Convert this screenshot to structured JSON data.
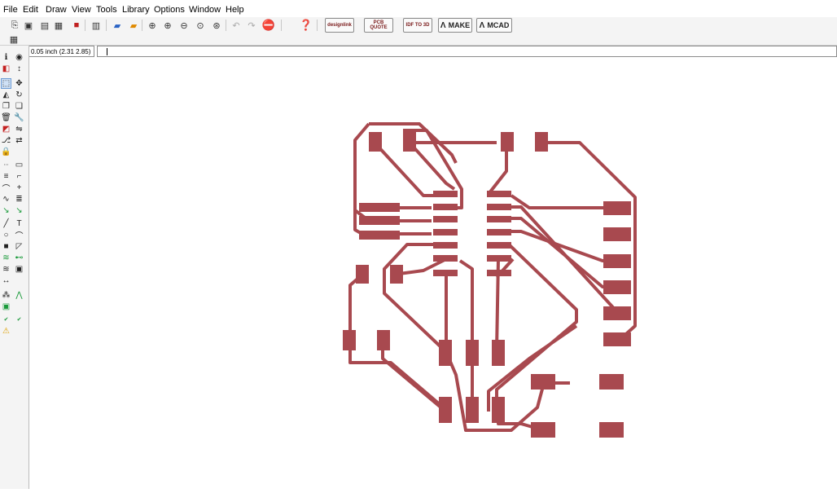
{
  "menu": [
    "File",
    "Edit",
    "Draw",
    "View",
    "Tools",
    "Library",
    "Options",
    "Window",
    "Help"
  ],
  "toolbar": {
    "icons": [
      "open-icon",
      "save-icon",
      "print-icon",
      "cam-icon",
      "board-icon",
      "schematic-icon",
      "ulp-icon",
      "script-icon",
      "zoom-fit-icon",
      "zoom-in-icon",
      "zoom-out-icon",
      "zoom-select-icon",
      "zoom-redraw-icon",
      "undo-icon",
      "redo-icon",
      "stop-icon",
      "help-icon"
    ],
    "buttons": [
      {
        "name": "designlink-button",
        "label": "designlink"
      },
      {
        "name": "pcb-quote-button",
        "label": "PCB QUOTE"
      },
      {
        "name": "idf-to-3d-button",
        "label": "IDF TO 3D"
      },
      {
        "name": "make-button",
        "label": "MAKE"
      },
      {
        "name": "mcad-button",
        "label": "MCAD"
      }
    ]
  },
  "status": {
    "coordinate": "0.05 inch (2.31 2.85)",
    "command": ""
  },
  "colors": {
    "trace": "#a8494f",
    "pad": "#a8494f",
    "canvas": "#ffffff"
  },
  "left_tools": [
    "info-icon",
    "eye-icon",
    "display-layers-icon",
    "mark-icon",
    "move-icon",
    "select-icon",
    "mirror-icon",
    "rotate-icon",
    "copy-icon",
    "paste-icon",
    "delete-icon",
    "change-icon",
    "group-icon",
    "replace-icon",
    "split-icon",
    "pinswap-icon",
    "lock-icon",
    "optimize-icon",
    "smash-icon",
    "miter-icon",
    "route-icon",
    "ripup-icon",
    "wire-icon",
    "text-icon",
    "circle-icon",
    "arc-icon",
    "rect-icon",
    "polygon-icon",
    "via-icon",
    "hole-icon",
    "attribute-icon",
    "dimension-icon",
    "ratsnest-icon",
    "autorouter-icon",
    "erc-icon",
    "drc-icon",
    "errors-icon"
  ]
}
